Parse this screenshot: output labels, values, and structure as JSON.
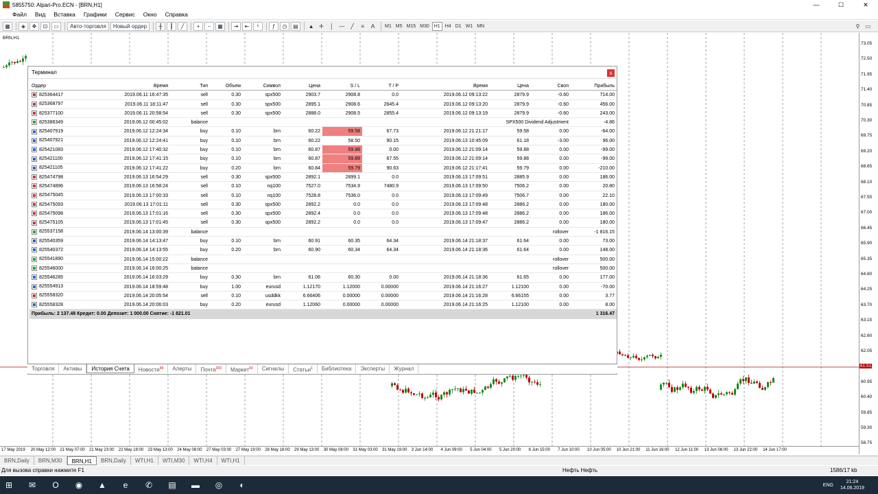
{
  "window": {
    "title": "5855750: Alpari-Pro.ECN - [BRN,H1]",
    "minimize": "—",
    "maximize": "☐",
    "close": "✕"
  },
  "menu": [
    "Файл",
    "Вид",
    "Вставка",
    "Графики",
    "Сервис",
    "Окно",
    "Справка"
  ],
  "toolbar": {
    "autotrading": "Авто-торговля",
    "new_order": "Новый ордер",
    "timeframes": [
      "M1",
      "M5",
      "M15",
      "M30",
      "H1",
      "H4",
      "D1",
      "W1",
      "MN"
    ]
  },
  "chart": {
    "symbol_label": "BRN,H1",
    "current_price": "61.51",
    "price_ticks": [
      "73.05",
      "72.50",
      "71.95",
      "71.40",
      "70.85",
      "70.30",
      "69.75",
      "69.20",
      "68.65",
      "68.10",
      "67.55",
      "67.00",
      "66.45",
      "65.90",
      "65.35",
      "64.80",
      "64.25",
      "63.70",
      "63.15",
      "62.60",
      "62.05",
      "61.51",
      "60.95",
      "60.40",
      "59.85",
      "59.30",
      "58.75"
    ],
    "time_ticks": [
      "17 May 2019",
      "20 May 12:00",
      "21 May 07:00",
      "21 May 23:00",
      "22 May 18:00",
      "23 May 13:00",
      "24 May 08:00",
      "27 May 03:00",
      "27 May 19:00",
      "28 May 18:00",
      "29 May 13:00",
      "30 May 08:00",
      "31 May 03:00",
      "31 May 19:00",
      "3 Jun 14:00",
      "4 Jun 09:00",
      "5 Jun 04:00",
      "5 Jun 20:00",
      "6 Jun 15:00",
      "7 Jun 10:00",
      "10 Jun 05:00",
      "10 Jun 21:00",
      "11 Jun 16:00",
      "12 Jun 11:00",
      "13 Jun 06:00",
      "13 Jun 22:00",
      "14 Jun 17:00"
    ]
  },
  "terminal": {
    "title": "Терминал",
    "close": "x",
    "headers": {
      "order": "Ордер",
      "time": "Время",
      "type": "Тип",
      "volume": "Объем",
      "symbol": "Символ",
      "price": "Цена",
      "sl": "S / L",
      "tp": "T / P",
      "close_time": "Время",
      "close_price": "Цена",
      "swap": "Своп",
      "profit": "Прибыль"
    },
    "rows": [
      {
        "o": "825364417",
        "t": "2019.06.11 16:47:35",
        "ty": "sell",
        "v": "0.30",
        "s": "spx500",
        "p": "2903.7",
        "sl": "2908.8",
        "tp": "0.0",
        "ct": "2019.06.12 09:13:22",
        "cp": "2879.9",
        "sw": "-0.60",
        "pf": "714.00"
      },
      {
        "o": "825368797",
        "t": "2019.06.11 18:11:47",
        "ty": "sell",
        "v": "0.30",
        "s": "spx500",
        "p": "2895.1",
        "sl": "2908.6",
        "tp": "2645.4",
        "ct": "2019.06.12 09:13:20",
        "cp": "2879.9",
        "sw": "-0.60",
        "pf": "456.00"
      },
      {
        "o": "825377100",
        "t": "2019.06.11 20:58:54",
        "ty": "sell",
        "v": "0.30",
        "s": "spx500",
        "p": "2888.0",
        "sl": "2908.5",
        "tp": "2855.4",
        "ct": "2019.06.12 09:13:19",
        "cp": "2879.9",
        "sw": "-0.60",
        "pf": "243.00"
      },
      {
        "o": "825386349",
        "t": "2019.06.12 00:45:02",
        "ty": "balance",
        "v": "",
        "s": "",
        "p": "",
        "sl": "",
        "tp": "",
        "ct": "",
        "cp": "",
        "sw": "SPX500 Dividend Adjustment",
        "pf": "-4.86"
      },
      {
        "o": "825407919",
        "t": "2019.06.12 12:24:34",
        "ty": "buy",
        "v": "0.10",
        "s": "brn",
        "p": "60.22",
        "sl": "59.58",
        "tp": "67.73",
        "ct": "2019.06.12 21:21:17",
        "cp": "59.58",
        "sw": "0.00",
        "pf": "-64.00",
        "hit": true
      },
      {
        "o": "825407921",
        "t": "2019.06.12 12:24:41",
        "ty": "buy",
        "v": "0.10",
        "s": "brn",
        "p": "60.22",
        "sl": "58.50",
        "tp": "90.15",
        "ct": "2019.06.13 10:45:09",
        "cp": "61.18",
        "sw": "-3.00",
        "pf": "96.00"
      },
      {
        "o": "825421083",
        "t": "2019.06.12 17:40:32",
        "ty": "buy",
        "v": "0.10",
        "s": "brn",
        "p": "60.87",
        "sl": "59.88",
        "tp": "0.00",
        "ct": "2019.06.12 21:09:14",
        "cp": "59.88",
        "sw": "0.00",
        "pf": "-99.00",
        "hit": true
      },
      {
        "o": "825421100",
        "t": "2019.06.12 17:41:15",
        "ty": "buy",
        "v": "0.10",
        "s": "brn",
        "p": "60.87",
        "sl": "59.89",
        "tp": "67.55",
        "ct": "2019.06.12 21:09:14",
        "cp": "59.88",
        "sw": "0.00",
        "pf": "-99.00",
        "hit": true
      },
      {
        "o": "825421105",
        "t": "2019.06.12 17:41:22",
        "ty": "buy",
        "v": "0.20",
        "s": "brn",
        "p": "60.84",
        "sl": "59.79",
        "tp": "90.63",
        "ct": "2019.06.12 21:17:41",
        "cp": "59.79",
        "sw": "0.00",
        "pf": "-210.00",
        "hit": true
      },
      {
        "o": "825474798",
        "t": "2019.06.13 16:54:29",
        "ty": "sell",
        "v": "0.30",
        "s": "spx500",
        "p": "2892.1",
        "sl": "2899.1",
        "tp": "0.0",
        "ct": "2019.06.13 17:09:51",
        "cp": "2885.9",
        "sw": "0.00",
        "pf": "186.00"
      },
      {
        "o": "825474896",
        "t": "2019.06.13 16:58:24",
        "ty": "sell",
        "v": "0.10",
        "s": "nq100",
        "p": "7527.0",
        "sl": "7534.9",
        "tp": "7480.9",
        "ct": "2019.06.13 17:09:50",
        "cp": "7506.2",
        "sw": "0.00",
        "pf": "20.80"
      },
      {
        "o": "825475045",
        "t": "2019.06.13 17:00:33",
        "ty": "sell",
        "v": "0.10",
        "s": "nq100",
        "p": "7528.8",
        "sl": "7536.0",
        "tp": "0.0",
        "ct": "2019.06.13 17:09:49",
        "cp": "7506.7",
        "sw": "0.00",
        "pf": "22.10"
      },
      {
        "o": "825475093",
        "t": "2019.06.13 17:01:11",
        "ty": "sell",
        "v": "0.30",
        "s": "spx500",
        "p": "2892.2",
        "sl": "0.0",
        "tp": "0.0",
        "ct": "2019.06.13 17:09:48",
        "cp": "2886.2",
        "sw": "0.00",
        "pf": "180.00"
      },
      {
        "o": "825475098",
        "t": "2019.06.13 17:01:16",
        "ty": "sell",
        "v": "0.30",
        "s": "spx500",
        "p": "2892.4",
        "sl": "0.0",
        "tp": "0.0",
        "ct": "2019.06.13 17:09:48",
        "cp": "2886.2",
        "sw": "0.00",
        "pf": "186.00"
      },
      {
        "o": "825475105",
        "t": "2019.06.13 17:01:45",
        "ty": "sell",
        "v": "0.30",
        "s": "spx500",
        "p": "2892.2",
        "sl": "0.0",
        "tp": "0.0",
        "ct": "2019.06.13 17:09:47",
        "cp": "2886.2",
        "sw": "0.00",
        "pf": "180.00"
      },
      {
        "o": "825537158",
        "t": "2019.06.14 13:00:39",
        "ty": "balance",
        "v": "",
        "s": "",
        "p": "",
        "sl": "",
        "tp": "",
        "ct": "",
        "cp": "",
        "sw": "rollover",
        "pf": "-1 816.15"
      },
      {
        "o": "825540359",
        "t": "2019.06.14 14:13:47",
        "ty": "buy",
        "v": "0.10",
        "s": "brn",
        "p": "60.91",
        "sl": "60.35",
        "tp": "64.34",
        "ct": "2019.06.14 21:18:37",
        "cp": "61.64",
        "sw": "0.00",
        "pf": "73.00"
      },
      {
        "o": "825540372",
        "t": "2019.06.14 14:13:55",
        "ty": "buy",
        "v": "0.20",
        "s": "brn",
        "p": "60.90",
        "sl": "60.34",
        "tp": "64.34",
        "ct": "2019.06.14 21:18:36",
        "cp": "61.64",
        "sw": "0.00",
        "pf": "148.00"
      },
      {
        "o": "825541890",
        "t": "2019.06.14 15:00:22",
        "ty": "balance",
        "v": "",
        "s": "",
        "p": "",
        "sl": "",
        "tp": "",
        "ct": "",
        "cp": "",
        "sw": "rollover",
        "pf": "500.00"
      },
      {
        "o": "825546000",
        "t": "2019.06.14 16:00:25",
        "ty": "balance",
        "v": "",
        "s": "",
        "p": "",
        "sl": "",
        "tp": "",
        "ct": "",
        "cp": "",
        "sw": "rollover",
        "pf": "500.00"
      },
      {
        "o": "825546285",
        "t": "2019.06.14 16:03:29",
        "ty": "buy",
        "v": "0.30",
        "s": "brn",
        "p": "61.06",
        "sl": "60.30",
        "tp": "0.00",
        "ct": "2019.06.14 21:18:36",
        "cp": "61.65",
        "sw": "0.00",
        "pf": "177.00"
      },
      {
        "o": "825554913",
        "t": "2019.06.14 18:59:48",
        "ty": "buy",
        "v": "1.00",
        "s": "eurusd",
        "p": "1.12170",
        "sl": "1.12000",
        "tp": "0.00000",
        "ct": "2019.06.14 21:16:27",
        "cp": "1.12100",
        "sw": "0.00",
        "pf": "-70.00"
      },
      {
        "o": "825558320",
        "t": "2019.06.14 20:05:54",
        "ty": "sell",
        "v": "0.10",
        "s": "usddkk",
        "p": "6.66406",
        "sl": "0.00000",
        "tp": "0.00000",
        "ct": "2019.06.14 21:16:28",
        "cp": "6.66155",
        "sw": "0.00",
        "pf": "3.77"
      },
      {
        "o": "825558328",
        "t": "2019.06.14 20:06:03",
        "ty": "buy",
        "v": "0.20",
        "s": "eurusd",
        "p": "1.12060",
        "sl": "0.00000",
        "tp": "0.00000",
        "ct": "2019.06.14 21:16:25",
        "cp": "1.12100",
        "sw": "0.00",
        "pf": "8.00"
      }
    ],
    "summary": "Прибыль: 2 137.48  Кредит: 0.00  Депозит: 1 000.00  Снятие: -1 821.01",
    "summary_total": "1 316.47",
    "tabs": [
      {
        "label": "Торговля"
      },
      {
        "label": "Активы"
      },
      {
        "label": "История Счета"
      },
      {
        "label": "Новости",
        "badge": "99"
      },
      {
        "label": "Алерты"
      },
      {
        "label": "Почта",
        "badge": "203"
      },
      {
        "label": "Маркет",
        "badge": "93"
      },
      {
        "label": "Сигналы"
      },
      {
        "label": "Статьи",
        "badge": "1"
      },
      {
        "label": "Библиотека"
      },
      {
        "label": "Эксперты"
      },
      {
        "label": "Журнал"
      }
    ]
  },
  "chart_tabs": [
    "BRN,Daily",
    "BRN,M30",
    "BRN,H1",
    "BRN,Daily",
    "WTI,H1",
    "WTI,M30",
    "WTI,H4",
    "WTI,H1"
  ],
  "status": {
    "help": "Для вызова справки нажмите F1",
    "profile": "Нефть Нефть",
    "traffic": "1586/17 kb"
  },
  "taskbar": {
    "lang": "ENG",
    "time": "21:24",
    "date": "14.06.2019"
  },
  "colors": {
    "sl_hit": "#f08080",
    "price_line": "#b00000",
    "bull": "#1a8a1a",
    "bear": "#c00000"
  }
}
